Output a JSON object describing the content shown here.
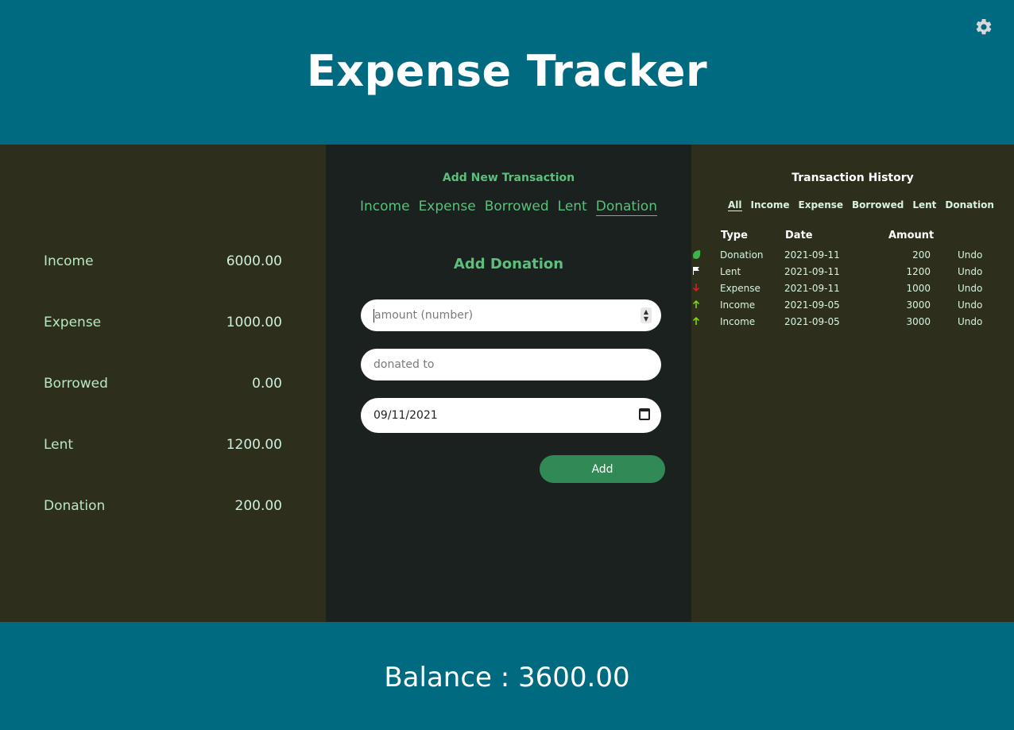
{
  "header": {
    "title": "Expense Tracker",
    "settings_icon": "gear-icon"
  },
  "summary": [
    {
      "label": "Income",
      "value": "6000.00"
    },
    {
      "label": "Expense",
      "value": "1000.00"
    },
    {
      "label": "Borrowed",
      "value": "0.00"
    },
    {
      "label": "Lent",
      "value": "1200.00"
    },
    {
      "label": "Donation",
      "value": "200.00"
    }
  ],
  "add_panel": {
    "title": "Add New Transaction",
    "tabs": [
      "Income",
      "Expense",
      "Borrowed",
      "Lent",
      "Donation"
    ],
    "active_tab": "Donation",
    "form_title": "Add Donation",
    "amount_placeholder": "amount (number)",
    "donated_to_placeholder": "donated to",
    "date_value": "09/11/2021",
    "add_label": "Add"
  },
  "history": {
    "title": "Transaction History",
    "filters": [
      "All",
      "Income",
      "Expense",
      "Borrowed",
      "Lent",
      "Donation"
    ],
    "active_filter": "All",
    "columns": [
      "Type",
      "Date",
      "Amount"
    ],
    "rows": [
      {
        "type": "Donation",
        "date": "2021-09-11",
        "amount": "200",
        "icon": "leaf-icon",
        "icon_color": "#3cb44b",
        "action": "Undo"
      },
      {
        "type": "Lent",
        "date": "2021-09-11",
        "amount": "1200",
        "icon": "flag-icon",
        "icon_color": "#ffffff",
        "action": "Undo"
      },
      {
        "type": "Expense",
        "date": "2021-09-11",
        "amount": "1000",
        "icon": "arrow-down-icon",
        "icon_color": "#e02020",
        "action": "Undo"
      },
      {
        "type": "Income",
        "date": "2021-09-05",
        "amount": "3000",
        "icon": "arrow-up-icon",
        "icon_color": "#7ee000",
        "action": "Undo"
      },
      {
        "type": "Income",
        "date": "2021-09-05",
        "amount": "3000",
        "icon": "arrow-up-icon",
        "icon_color": "#7ee000",
        "action": "Undo"
      }
    ]
  },
  "footer": {
    "balance_label": "Balance : 3600.00"
  },
  "colors": {
    "header_bg": "#006a81",
    "side_bg": "#2d2f1c",
    "middle_bg": "#1a211e",
    "accent_green": "#5cbf7c",
    "button_green": "#318a56"
  }
}
